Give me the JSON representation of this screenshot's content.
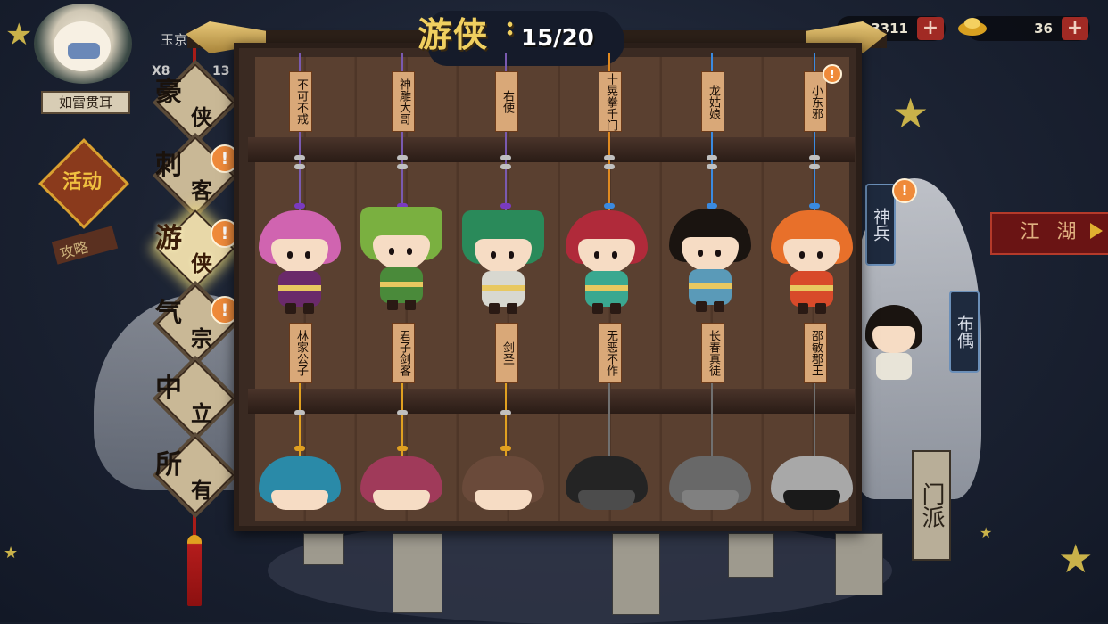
{
  "header": {
    "player_name": "如雷贯耳",
    "top_label": "玉京",
    "stat_left": "X8",
    "stat_right": "13"
  },
  "currency": [
    {
      "value": "3311",
      "icon": "coin-icon"
    },
    {
      "value": "36",
      "icon": "gold-ingot-icon"
    }
  ],
  "left_panel": {
    "charm_text": "活动",
    "tag_text": "攻略"
  },
  "categories": [
    {
      "ch1": "豪",
      "ch2": "侠",
      "alert": false,
      "active": false
    },
    {
      "ch1": "刺",
      "ch2": "客",
      "alert": true,
      "active": false
    },
    {
      "ch1": "游",
      "ch2": "侠",
      "alert": true,
      "active": true
    },
    {
      "ch1": "气",
      "ch2": "宗",
      "alert": true,
      "active": false
    },
    {
      "ch1": "中",
      "ch2": "立",
      "alert": false,
      "active": false
    },
    {
      "ch1": "所",
      "ch2": "有",
      "alert": false,
      "active": false
    }
  ],
  "alert_symbol": "!",
  "panel": {
    "title": "游侠",
    "separator": ":",
    "count": "15/20"
  },
  "top_row_tags": [
    "不可不戒",
    "神雕大哥",
    "右使",
    "十晃拳千门",
    "龙姑娘",
    "小东邪"
  ],
  "middle_row_tags": [
    "林家公子",
    "君子剑客",
    "剑圣",
    "无恶不作",
    "长春真徒",
    "邵敏郡王"
  ],
  "right_side": {
    "tag1": "神兵",
    "tag2": "布偶",
    "jianghu": "江 湖",
    "menpai": "门派"
  },
  "colors": {
    "accent_gold": "#f0d060",
    "alert_orange": "#ef8a3a",
    "tassel_red": "#a81c18",
    "shelf_wood": "#5a4030"
  }
}
